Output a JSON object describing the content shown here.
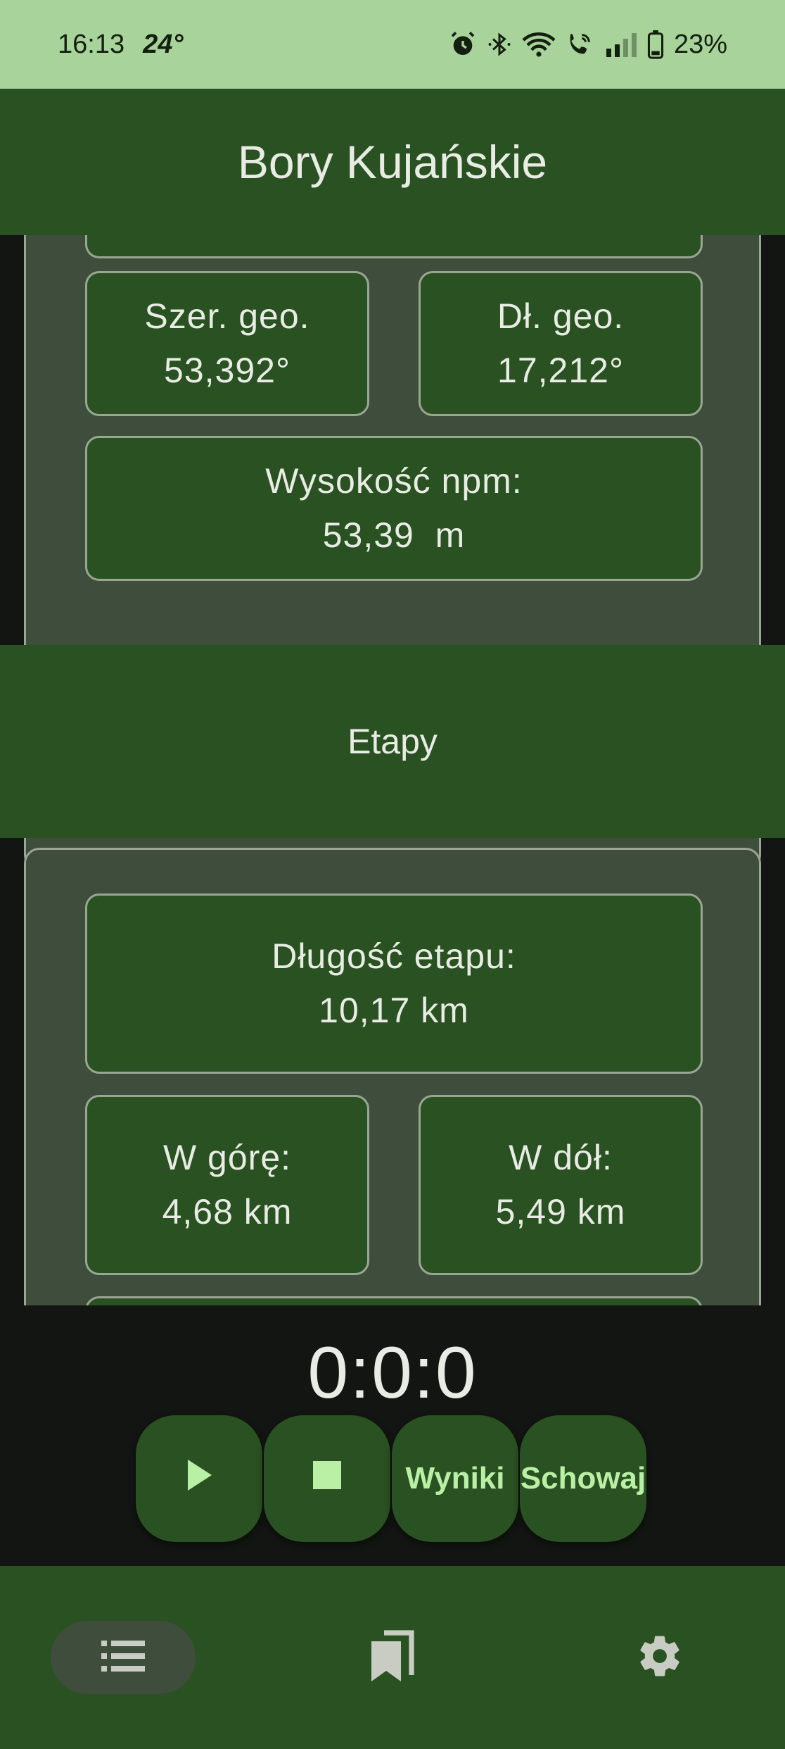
{
  "status_bar": {
    "time": "16:13",
    "temperature": "24°",
    "battery": "23%",
    "icons": [
      "alarm-icon",
      "bluetooth-icon",
      "wifi-icon",
      "wifi-calling-icon",
      "signal-icon",
      "battery-icon"
    ]
  },
  "app_bar": {
    "title": "Bory Kujańskie"
  },
  "location_panel": {
    "latitude": {
      "label": "Szer. geo.",
      "value": "53,392°"
    },
    "longitude": {
      "label": "Dł. geo.",
      "value": "17,212°"
    },
    "altitude": {
      "label": "Wysokość npm:",
      "value": "53,39  m"
    }
  },
  "stages_header": {
    "title": "Etapy"
  },
  "stage_panel": {
    "length": {
      "label": "Długość etapu:",
      "value": "10,17 km"
    },
    "up": {
      "label": "W górę:",
      "value": "4,68 km"
    },
    "down": {
      "label": "W dół:",
      "value": "5,49 km"
    }
  },
  "timer": {
    "value": "0:0:0"
  },
  "controls": {
    "play_icon": "play-icon",
    "stop_icon": "stop-icon",
    "results_label": "Wyniki",
    "hide_label": "Schowaj"
  },
  "bottom_nav": {
    "items": [
      {
        "icon": "list-icon",
        "active": true
      },
      {
        "icon": "bookmarks-icon",
        "active": false
      },
      {
        "icon": "settings-icon",
        "active": false
      }
    ]
  },
  "colors": {
    "status_bar_bg": "#a8d39b",
    "primary_green": "#2a5121",
    "panel_bg": "#3f4d3c",
    "border": "#9aa693",
    "background": "#121512",
    "accent": "#b9f0a6",
    "text": "#e8ece4"
  }
}
